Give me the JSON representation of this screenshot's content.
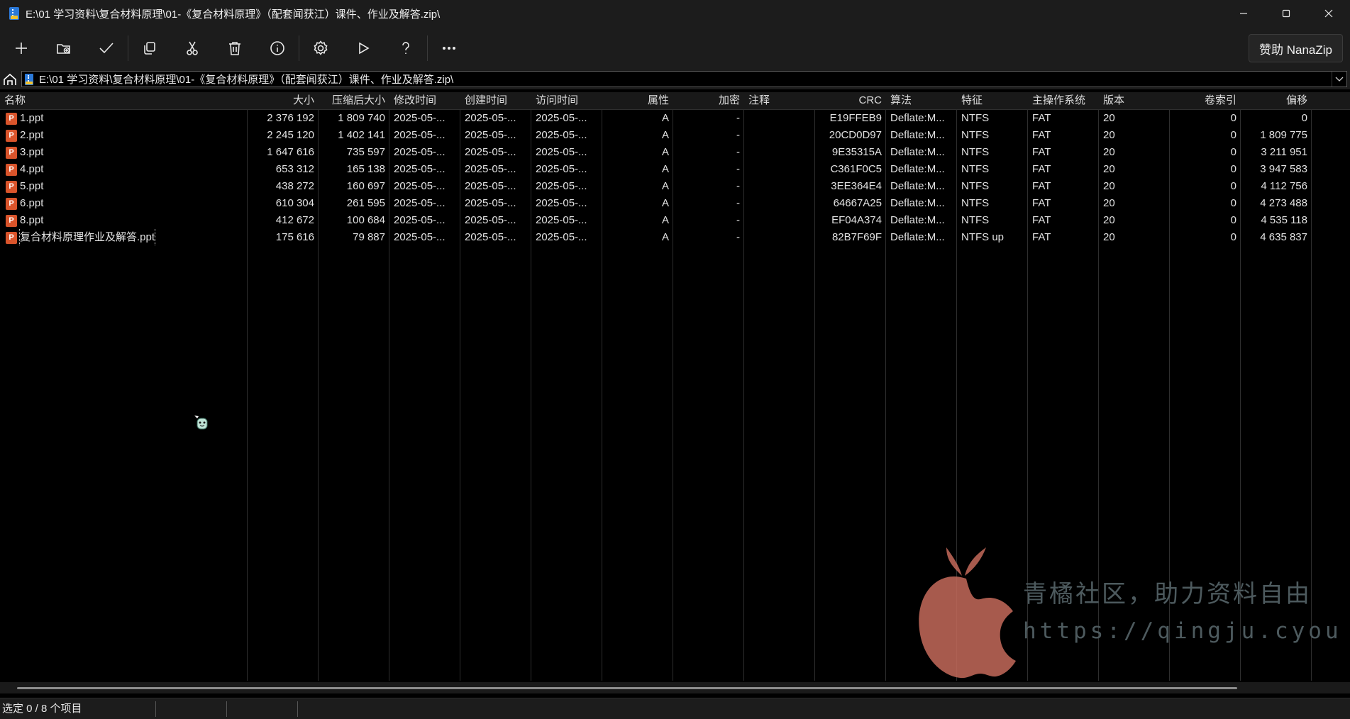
{
  "window": {
    "title": "E:\\01 学习资料\\复合材料原理\\01-《复合材料原理》（配套闻获江）课件、作业及解答.zip\\"
  },
  "toolbar": {
    "buttons": [
      {
        "name": "add-button",
        "icon": "plus-icon"
      },
      {
        "name": "extract-button",
        "icon": "folder-extract-icon"
      },
      {
        "name": "test-button",
        "icon": "checkmark-icon"
      },
      {
        "name": "copy-button",
        "icon": "copy-icon"
      },
      {
        "name": "move-button",
        "icon": "scissors-icon"
      },
      {
        "name": "delete-button",
        "icon": "trash-icon"
      },
      {
        "name": "info-button",
        "icon": "info-icon"
      },
      {
        "name": "settings-button",
        "icon": "gear-icon"
      },
      {
        "name": "benchmark-button",
        "icon": "play-icon"
      },
      {
        "name": "help-button",
        "icon": "question-icon"
      },
      {
        "name": "more-button",
        "icon": "ellipsis-icon"
      }
    ],
    "sponsor_label": "赞助 NanaZip"
  },
  "address": {
    "path": "E:\\01 学习资料\\复合材料原理\\01-《复合材料原理》（配套闻获江）课件、作业及解答.zip\\"
  },
  "columns": [
    "名称",
    "大小",
    "压缩后大小",
    "修改时间",
    "创建时间",
    "访问时间",
    "属性",
    "加密",
    "注释",
    "CRC",
    "算法",
    "特征",
    "主操作系统",
    "版本",
    "卷索引",
    "偏移"
  ],
  "files": [
    {
      "name": "1.ppt",
      "size": "2 376 192",
      "packed": "1 809 740",
      "modified": "2025-05-...",
      "created": "2025-05-...",
      "accessed": "2025-05-...",
      "attr": "A",
      "enc": "-",
      "comment": "",
      "crc": "E19FFEB9",
      "method": "Deflate:M...",
      "char": "NTFS",
      "hostos": "FAT",
      "ver": "20",
      "vol": "0",
      "offset": "0"
    },
    {
      "name": "2.ppt",
      "size": "2 245 120",
      "packed": "1 402 141",
      "modified": "2025-05-...",
      "created": "2025-05-...",
      "accessed": "2025-05-...",
      "attr": "A",
      "enc": "-",
      "comment": "",
      "crc": "20CD0D97",
      "method": "Deflate:M...",
      "char": "NTFS",
      "hostos": "FAT",
      "ver": "20",
      "vol": "0",
      "offset": "1 809 775"
    },
    {
      "name": "3.ppt",
      "size": "1 647 616",
      "packed": "735 597",
      "modified": "2025-05-...",
      "created": "2025-05-...",
      "accessed": "2025-05-...",
      "attr": "A",
      "enc": "-",
      "comment": "",
      "crc": "9E35315A",
      "method": "Deflate:M...",
      "char": "NTFS",
      "hostos": "FAT",
      "ver": "20",
      "vol": "0",
      "offset": "3 211 951"
    },
    {
      "name": "4.ppt",
      "size": "653 312",
      "packed": "165 138",
      "modified": "2025-05-...",
      "created": "2025-05-...",
      "accessed": "2025-05-...",
      "attr": "A",
      "enc": "-",
      "comment": "",
      "crc": "C361F0C5",
      "method": "Deflate:M...",
      "char": "NTFS",
      "hostos": "FAT",
      "ver": "20",
      "vol": "0",
      "offset": "3 947 583"
    },
    {
      "name": "5.ppt",
      "size": "438 272",
      "packed": "160 697",
      "modified": "2025-05-...",
      "created": "2025-05-...",
      "accessed": "2025-05-...",
      "attr": "A",
      "enc": "-",
      "comment": "",
      "crc": "3EE364E4",
      "method": "Deflate:M...",
      "char": "NTFS",
      "hostos": "FAT",
      "ver": "20",
      "vol": "0",
      "offset": "4 112 756"
    },
    {
      "name": "6.ppt",
      "size": "610 304",
      "packed": "261 595",
      "modified": "2025-05-...",
      "created": "2025-05-...",
      "accessed": "2025-05-...",
      "attr": "A",
      "enc": "-",
      "comment": "",
      "crc": "64667A25",
      "method": "Deflate:M...",
      "char": "NTFS",
      "hostos": "FAT",
      "ver": "20",
      "vol": "0",
      "offset": "4 273 488"
    },
    {
      "name": "8.ppt",
      "size": "412 672",
      "packed": "100 684",
      "modified": "2025-05-...",
      "created": "2025-05-...",
      "accessed": "2025-05-...",
      "attr": "A",
      "enc": "-",
      "comment": "",
      "crc": "EF04A374",
      "method": "Deflate:M...",
      "char": "NTFS",
      "hostos": "FAT",
      "ver": "20",
      "vol": "0",
      "offset": "4 535 118"
    },
    {
      "name": "复合材料原理作业及解答.ppt",
      "size": "175 616",
      "packed": "79 887",
      "modified": "2025-05-...",
      "created": "2025-05-...",
      "accessed": "2025-05-...",
      "attr": "A",
      "enc": "-",
      "comment": "",
      "crc": "82B7F69F",
      "method": "Deflate:M...",
      "char": "NTFS up",
      "hostos": "FAT",
      "ver": "20",
      "vol": "0",
      "offset": "4 635 837"
    }
  ],
  "file_icon_glyph": "P",
  "status": {
    "selection": "选定 0 / 8 个项目",
    "seg2": "",
    "seg3": "",
    "seg4": ""
  },
  "watermark": {
    "title": "青橘社区，助力资料自由",
    "url": "https://qingju.cyou",
    "logo_color": "#c46a5a",
    "text_color": "#4d5a5e"
  },
  "colors": {
    "background": "#000000",
    "chrome": "#1c1c1c",
    "ppt_icon": "#d9542b"
  }
}
